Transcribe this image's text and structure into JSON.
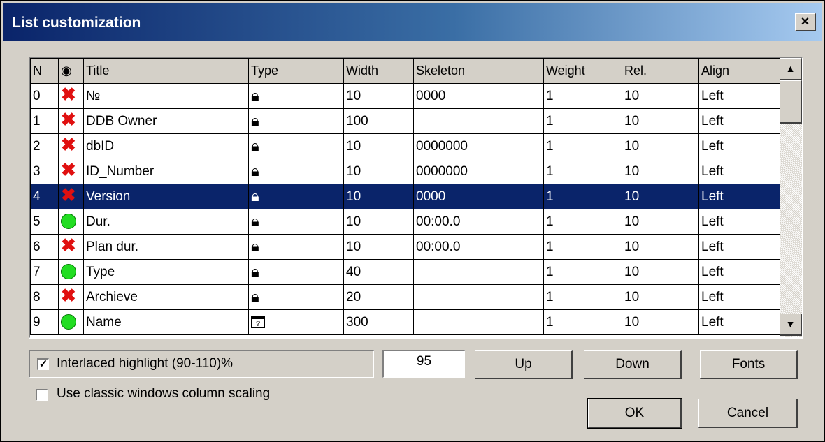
{
  "window": {
    "title": "List customization",
    "close_label": "×"
  },
  "columns": [
    "N",
    "",
    "Title",
    "Type",
    "Width",
    "Skeleton",
    "Weight",
    "Rel.",
    "Align"
  ],
  "rows": [
    {
      "n": "0",
      "visible": false,
      "title": "№",
      "type_icon": "lock-icon",
      "width": "10",
      "skeleton": "0000",
      "weight": "1",
      "rel": "10",
      "align": "Left"
    },
    {
      "n": "1",
      "visible": false,
      "title": "DDB Owner",
      "type_icon": "lock-icon",
      "width": "100",
      "skeleton": "",
      "weight": "1",
      "rel": "10",
      "align": "Left"
    },
    {
      "n": "2",
      "visible": false,
      "title": "dbID",
      "type_icon": "lock-icon",
      "width": "10",
      "skeleton": "0000000",
      "weight": "1",
      "rel": "10",
      "align": "Left"
    },
    {
      "n": "3",
      "visible": false,
      "title": "ID_Number",
      "type_icon": "lock-icon",
      "width": "10",
      "skeleton": "0000000",
      "weight": "1",
      "rel": "10",
      "align": "Left"
    },
    {
      "n": "4",
      "visible": false,
      "title": "Version",
      "type_icon": "lock-icon",
      "width": "10",
      "skeleton": "0000",
      "weight": "1",
      "rel": "10",
      "align": "Left",
      "selected": true
    },
    {
      "n": "5",
      "visible": true,
      "title": "Dur.",
      "type_icon": "lock-icon",
      "width": "10",
      "skeleton": "00:00.0",
      "weight": "1",
      "rel": "10",
      "align": "Left"
    },
    {
      "n": "6",
      "visible": false,
      "title": "Plan dur.",
      "type_icon": "lock-icon",
      "width": "10",
      "skeleton": "00:00.0",
      "weight": "1",
      "rel": "10",
      "align": "Left"
    },
    {
      "n": "7",
      "visible": true,
      "title": "Type",
      "type_icon": "lock-icon",
      "width": "40",
      "skeleton": "",
      "weight": "1",
      "rel": "10",
      "align": "Left"
    },
    {
      "n": "8",
      "visible": false,
      "title": "Archieve",
      "type_icon": "lock-icon",
      "width": "20",
      "skeleton": "",
      "weight": "1",
      "rel": "10",
      "align": "Left"
    },
    {
      "n": "9",
      "visible": true,
      "title": "Name",
      "type_icon": "editable-window-icon",
      "width": "300",
      "skeleton": "",
      "weight": "1",
      "rel": "10",
      "align": "Left"
    }
  ],
  "options": {
    "interlaced_label": "Interlaced highlight (90-110)%",
    "interlaced_checked": true,
    "interlaced_value": "95",
    "classic_scaling_label": "Use classic windows column scaling",
    "classic_scaling_checked": false
  },
  "buttons": {
    "up": "Up",
    "down": "Down",
    "fonts": "Fonts",
    "ok": "OK",
    "cancel": "Cancel"
  },
  "colors": {
    "selection": "#0a246a",
    "hidden_mark": "#e01010",
    "visible_mark": "#22dd22"
  }
}
